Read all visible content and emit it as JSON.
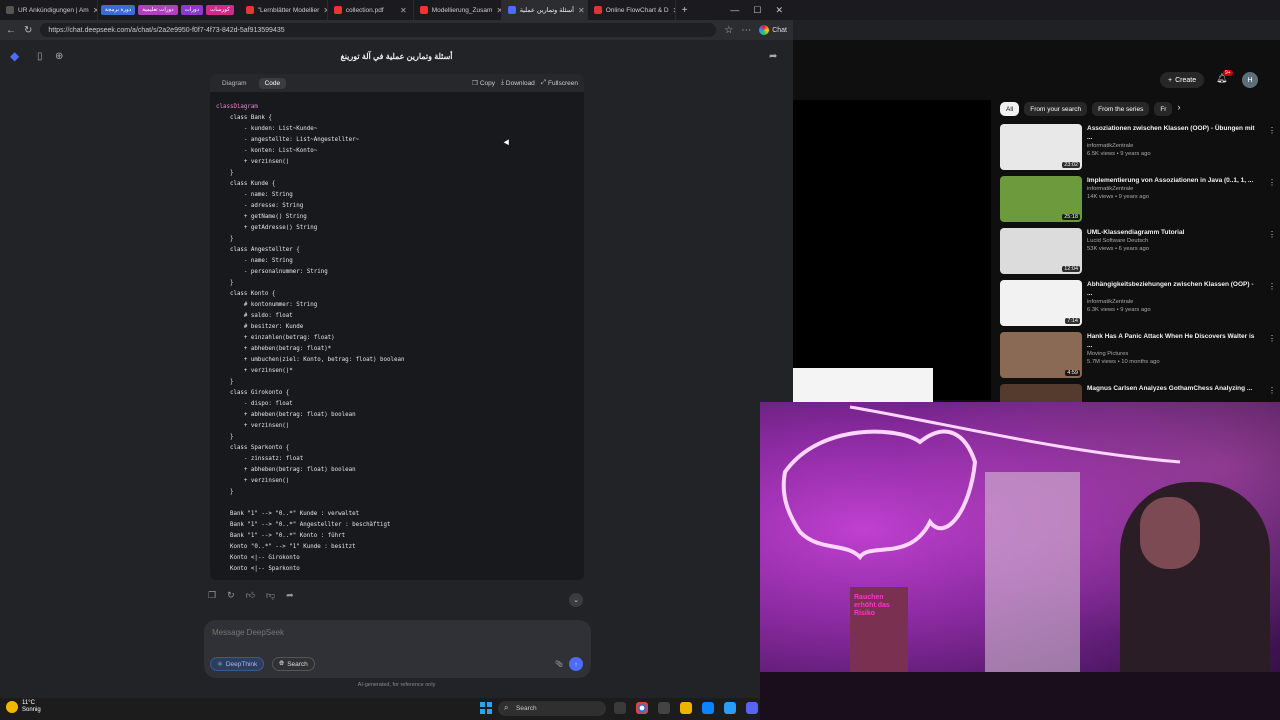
{
  "left_browser": {
    "tabs": [
      {
        "label": "UR Ankündigungen | Am",
        "active": false
      },
      {
        "label": "\"Lernblätter Modellier",
        "active": false
      },
      {
        "label": "collection.pdf",
        "active": false
      },
      {
        "label": "Modellierung_Zusam",
        "active": false
      },
      {
        "label": "أسئلة وتمارين عملية",
        "active": true
      },
      {
        "label": "Online FlowChart & D",
        "active": false
      }
    ],
    "pinned_pills": [
      "دورة برمجة",
      "دورات تعليمية",
      "دورات",
      "كورسات"
    ],
    "url": "https://chat.deepseek.com/a/chat/s/2a2e9950-f0f7-4f73-842d-5af913599435",
    "chat_button": "Chat"
  },
  "deepseek": {
    "title": "أسئلة وتمارين عملية في آلة تورينغ",
    "card": {
      "tab_diagram": "Diagram",
      "tab_code": "Code",
      "copy": "Copy",
      "download": "Download",
      "fullscreen": "Fullscreen"
    },
    "code_lines": [
      "classDiagram",
      "    class Bank {",
      "        - kunden: List~Kunde~",
      "        - angestellte: List~Angestellter~",
      "        - konten: List~Konto~",
      "        + verzinsen()",
      "    }",
      "    class Kunde {",
      "        - name: String",
      "        - adresse: String",
      "        + getName() String",
      "        + getAdresse() String",
      "    }",
      "    class Angestellter {",
      "        - name: String",
      "        - personalnummer: String",
      "    }",
      "    class Konto {",
      "        # kontonummer: String",
      "        # saldo: float",
      "        # besitzer: Kunde",
      "        + einzahlen(betrag: float)",
      "        + abheben(betrag: float)*",
      "        + umbuchen(ziel: Konto, betrag: float) boolean",
      "        + verzinsen()*",
      "    }",
      "    class Girokonto {",
      "        - dispo: float",
      "        + abheben(betrag: float) boolean",
      "        + verzinsen()",
      "    }",
      "    class Sparkonto {",
      "        - zinssatz: float",
      "        + abheben(betrag: float) boolean",
      "        + verzinsen()",
      "    }",
      "",
      "    Bank \"1\" --> \"0..*\" Kunde : verwaltet",
      "    Bank \"1\" --> \"0..*\" Angestellter : beschäftigt",
      "    Bank \"1\" --> \"0..*\" Konto : führt",
      "    Konto \"0..*\" --> \"1\" Kunde : besitzt",
      "    Konto <|-- Girokonto",
      "    Konto <|-- Sparkonto"
    ],
    "input_placeholder": "Message DeepSeek",
    "deepthink": "DeepThink",
    "search": "Search",
    "disclaimer": "AI-generated, for reference only"
  },
  "youtube": {
    "create": "Create",
    "notification_count": "9+",
    "avatar_letter": "H",
    "chips": [
      "All",
      "From your search",
      "From the series",
      "Fr"
    ],
    "videos": [
      {
        "title": "Assoziationen zwischen Klassen (OOP) - Übungen mit ...",
        "channel": "informatikZentrale",
        "meta": "6.5K views • 9 years ago",
        "duration": "23:02",
        "thumb": "#e8e8e8"
      },
      {
        "title": "Implementierung von Assoziationen in Java (0..1, 1, ...",
        "channel": "informatikZentrale",
        "meta": "14K views • 9 years ago",
        "duration": "25:18",
        "thumb": "#6c9a3c"
      },
      {
        "title": "UML-Klassendiagramm Tutorial",
        "channel": "Lucid Software Deutsch",
        "meta": "53K views • 6 years ago",
        "duration": "12:04",
        "thumb": "#dcdcdc"
      },
      {
        "title": "Abhängigkeitsbeziehungen zwischen Klassen (OOP) - ...",
        "channel": "informatikZentrale",
        "meta": "6.3K views • 9 years ago",
        "duration": "7:14",
        "thumb": "#f2f2f2"
      },
      {
        "title": "Hank Has A Panic Attack When He Discovers Walter is ...",
        "channel": "Moving Pictures",
        "meta": "5.7M views • 10 months ago",
        "duration": "4:59",
        "thumb": "#8a6a55"
      },
      {
        "title": "Magnus Carlsen Analyzes GothamChess Analyzing ...",
        "channel": "",
        "meta": "",
        "duration": "",
        "thumb": "#553a2e"
      }
    ]
  },
  "webcam": {
    "book_text": "Rauchen erhöht das Risiko"
  },
  "taskbar": {
    "temp": "11°C",
    "condition": "Sonnig",
    "search": "Search"
  }
}
